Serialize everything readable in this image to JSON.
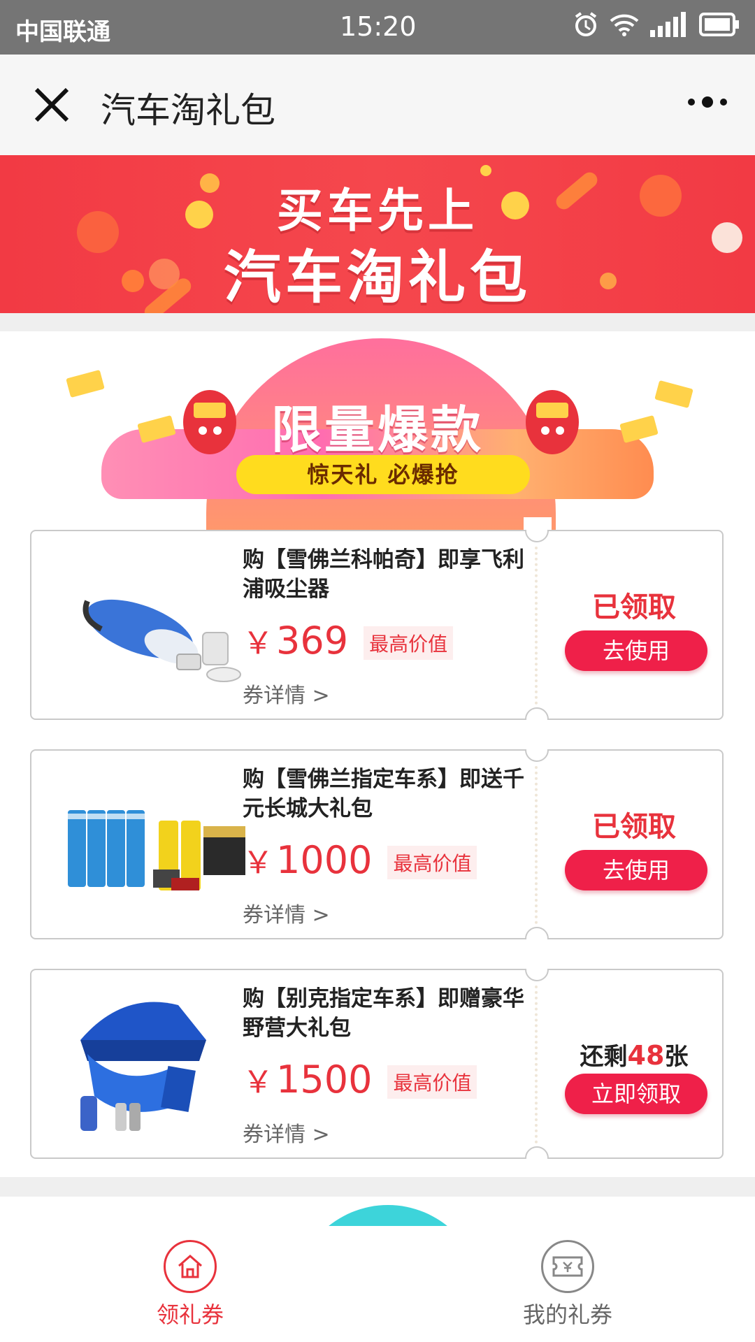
{
  "status_bar": {
    "carrier": "中国联通",
    "time": "15:20"
  },
  "nav": {
    "title": "汽车淘礼包"
  },
  "banner": {
    "line1": "买车先上",
    "line2": "汽车淘礼包"
  },
  "promo": {
    "title": "限量爆款",
    "subtitle": "惊天礼  必爆抢"
  },
  "coupons": [
    {
      "name": "购【雪佛兰科帕奇】即享飞利浦吸尘器",
      "currency": "￥",
      "price": "369",
      "tag": "最高价值",
      "detail": "券详情 >",
      "status": "已领取",
      "button": "去使用"
    },
    {
      "name": "购【雪佛兰指定车系】即送千元长城大礼包",
      "currency": "￥",
      "price": "1000",
      "tag": "最高价值",
      "detail": "券详情 >",
      "status": "已领取",
      "button": "去使用"
    },
    {
      "name": "购【别克指定车系】即赠豪华野营大礼包",
      "currency": "￥",
      "price": "1500",
      "tag": "最高价值",
      "detail": "券详情 >",
      "remain_prefix": "还剩",
      "remain_count": "48",
      "remain_suffix": "张",
      "button": "立即领取"
    }
  ],
  "tabs": [
    {
      "label": "领礼券",
      "icon": "home-icon",
      "active": true
    },
    {
      "label": "我的礼券",
      "icon": "ticket-icon",
      "active": false
    }
  ],
  "colors": {
    "accent": "#e8323c",
    "button": "#ef2049",
    "banner": "#f23a44",
    "status_bar": "#757575"
  }
}
